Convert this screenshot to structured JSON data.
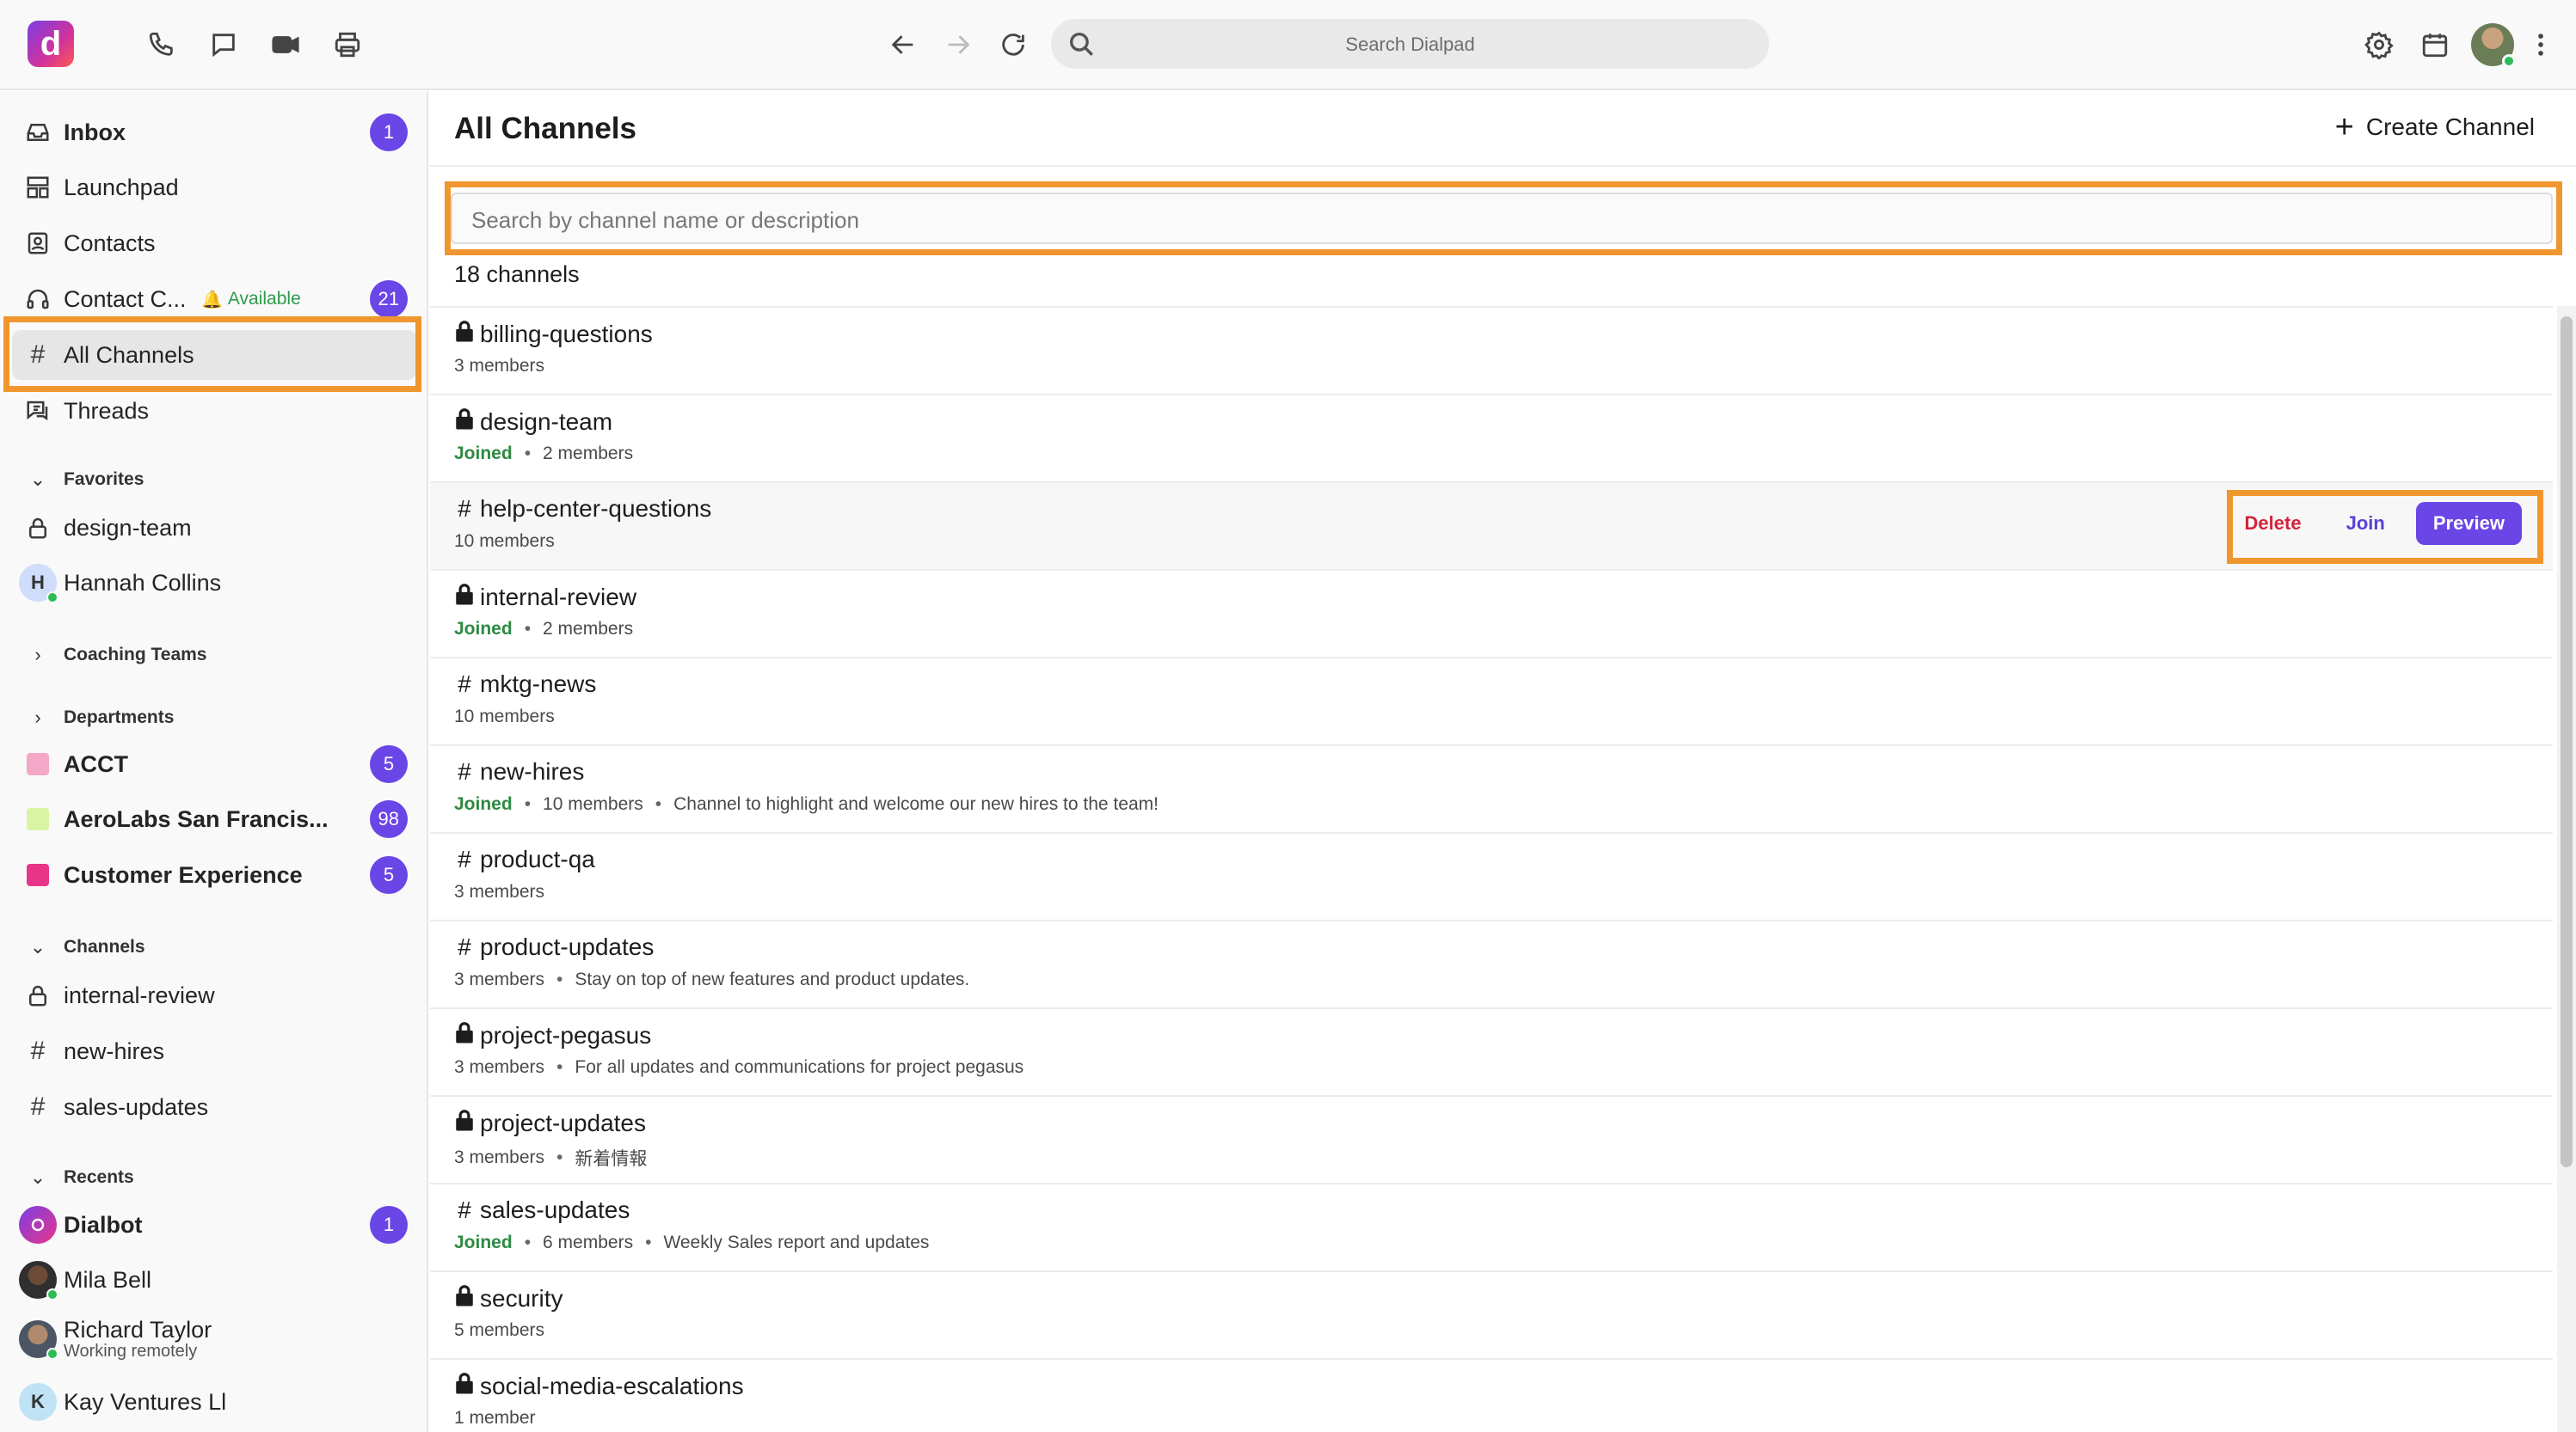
{
  "topbar": {
    "logo": "d",
    "search_placeholder": "Search Dialpad"
  },
  "sidebar": {
    "nav": [
      {
        "label": "Inbox",
        "badge": "1",
        "icon": "inbox-icon"
      },
      {
        "label": "Launchpad",
        "icon": "launchpad-icon"
      },
      {
        "label": "Contacts",
        "icon": "contacts-icon"
      },
      {
        "label": "Contact C...",
        "status": "Available",
        "badge": "21",
        "icon": "headset-icon"
      },
      {
        "label": "All Channels",
        "icon": "hash-icon"
      },
      {
        "label": "Threads",
        "icon": "threads-icon"
      }
    ],
    "favorites": {
      "title": "Favorites",
      "items": [
        {
          "label": "design-team",
          "icon": "lock-icon"
        },
        {
          "label": "Hannah Collins",
          "initial": "H"
        }
      ]
    },
    "coaching": {
      "title": "Coaching Teams"
    },
    "departments": {
      "title": "Departments",
      "items": [
        {
          "label": "ACCT",
          "badge": "5",
          "color": "#f4a7c7"
        },
        {
          "label": "AeroLabs San Francis...",
          "badge": "98",
          "color": "#d8f5a3"
        },
        {
          "label": "Customer Experience",
          "badge": "5",
          "color": "#e8358a"
        }
      ]
    },
    "channels": {
      "title": "Channels",
      "items": [
        {
          "label": "internal-review",
          "icon": "lock-icon"
        },
        {
          "label": "new-hires",
          "icon": "hash-icon"
        },
        {
          "label": "sales-updates",
          "icon": "hash-icon"
        }
      ]
    },
    "recents": {
      "title": "Recents",
      "items": [
        {
          "label": "Dialbot",
          "badge": "1"
        },
        {
          "label": "Mila Bell"
        },
        {
          "label": "Richard Taylor",
          "sub": "Working remotely"
        },
        {
          "label": "Kay Ventures Ll",
          "initial": "K"
        }
      ]
    }
  },
  "main": {
    "title": "All Channels",
    "create_label": "Create Channel",
    "search_placeholder": "Search by channel name or description",
    "count": "18 channels",
    "joined_label": "Joined",
    "actions": {
      "delete": "Delete",
      "join": "Join",
      "preview": "Preview"
    },
    "channels": [
      {
        "name": "billing-questions",
        "private": true,
        "members": "3 members"
      },
      {
        "name": "design-team",
        "private": true,
        "joined": true,
        "members": "2 members"
      },
      {
        "name": "help-center-questions",
        "private": false,
        "members": "10 members"
      },
      {
        "name": "internal-review",
        "private": true,
        "joined": true,
        "members": "2 members"
      },
      {
        "name": "mktg-news",
        "private": false,
        "members": "10 members"
      },
      {
        "name": "new-hires",
        "private": false,
        "joined": true,
        "members": "10 members",
        "description": "Channel to highlight and welcome our new hires to the team!"
      },
      {
        "name": "product-qa",
        "private": false,
        "members": "3 members"
      },
      {
        "name": "product-updates",
        "private": false,
        "members": "3 members",
        "description": "Stay on top of new features and product updates."
      },
      {
        "name": "project-pegasus",
        "private": true,
        "members": "3 members",
        "description": "For all updates and communications for project pegasus"
      },
      {
        "name": "project-updates",
        "private": true,
        "members": "3 members",
        "description": "新着情報"
      },
      {
        "name": "sales-updates",
        "private": false,
        "joined": true,
        "members": "6 members",
        "description": "Weekly Sales report and updates"
      },
      {
        "name": "security",
        "private": true,
        "members": "5 members"
      },
      {
        "name": "social-media-escalations",
        "private": true,
        "members": "1 member"
      }
    ]
  },
  "colors": {
    "accent": "#6a46e6",
    "highlight": "#f0962e",
    "joined": "#2e8a43",
    "delete": "#d4233a"
  }
}
